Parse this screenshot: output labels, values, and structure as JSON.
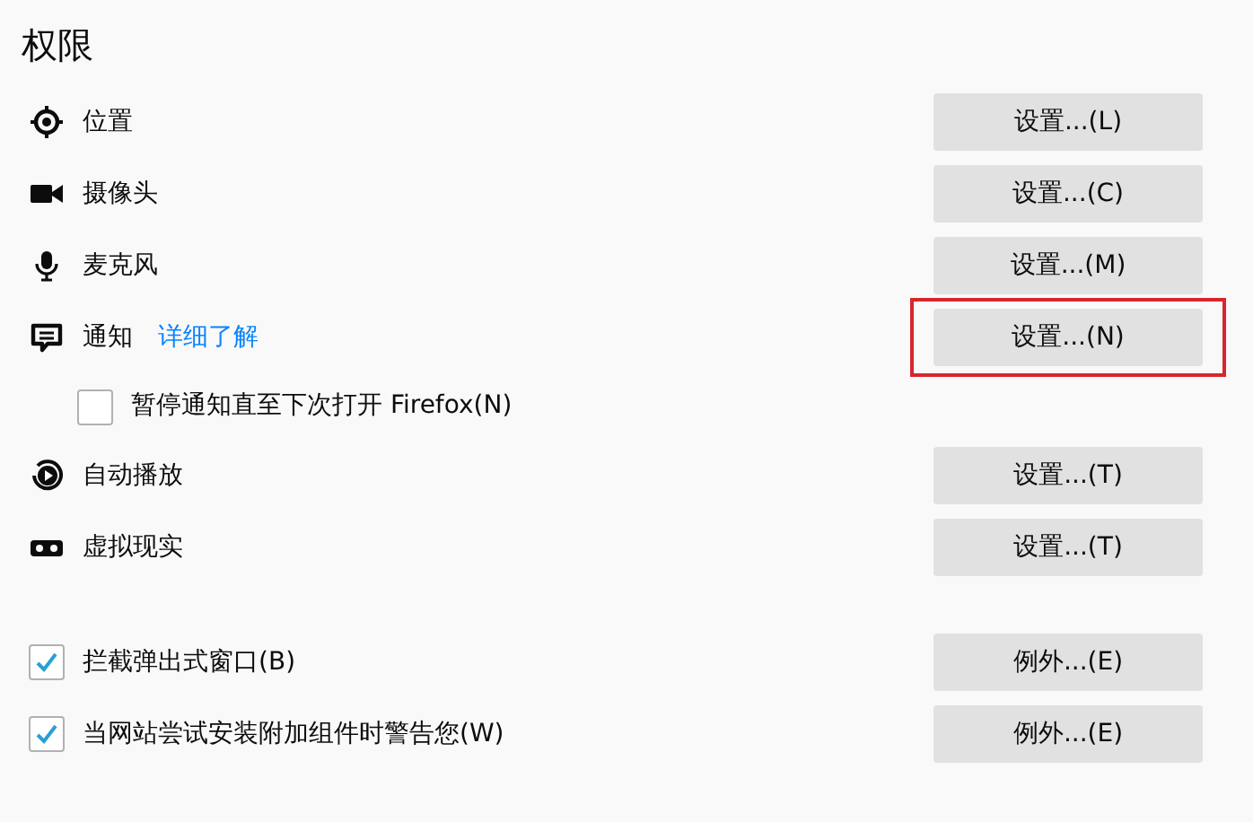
{
  "title": "权限",
  "permissions": [
    {
      "kind": "setting",
      "label": "位置",
      "button": "设置...(L)",
      "highlighted": false
    },
    {
      "kind": "setting",
      "label": "摄像头",
      "button": "设置...(C)",
      "highlighted": false
    },
    {
      "kind": "setting",
      "label": "麦克风",
      "button": "设置...(M)",
      "highlighted": false
    },
    {
      "kind": "setting",
      "label": "通知",
      "link": "详细了解",
      "button": "设置...(N)",
      "highlighted": true
    },
    {
      "kind": "checkbox",
      "label": "暂停通知直至下次打开 Firefox(N)",
      "checked": false
    },
    {
      "kind": "setting",
      "label": "自动播放",
      "button": "设置...(T)",
      "highlighted": false
    },
    {
      "kind": "setting",
      "label": "虚拟现实",
      "button": "设置...(T)",
      "highlighted": false
    }
  ],
  "options": [
    {
      "label": "拦截弹出式窗口(B)",
      "checked": true,
      "button": "例外...(E)"
    },
    {
      "label": "当网站尝试安装附加组件时警告您(W)",
      "checked": true,
      "button": "例外...(E)"
    }
  ]
}
